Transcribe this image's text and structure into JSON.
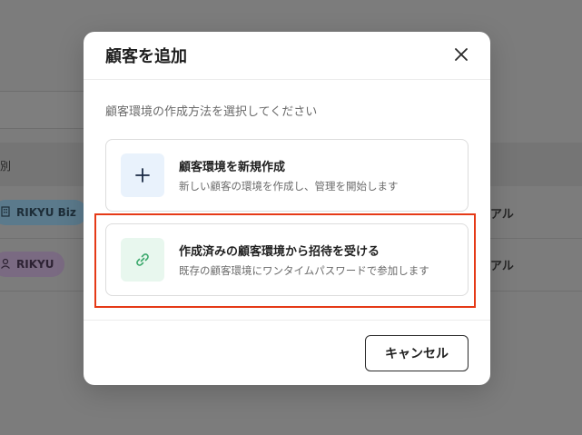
{
  "background": {
    "column_header": "種別",
    "rows": [
      {
        "badge": "RIKYU Biz",
        "cell": "アル"
      },
      {
        "badge": "RIKYU",
        "cell": "アル"
      }
    ]
  },
  "modal": {
    "title": "顧客を追加",
    "description": "顧客環境の作成方法を選択してください",
    "options": [
      {
        "title": "顧客環境を新規作成",
        "subtitle": "新しい顧客の環境を作成し、管理を開始します",
        "icon": "plus-icon"
      },
      {
        "title": "作成済みの顧客環境から招待を受ける",
        "subtitle": "既存の顧客環境にワンタイムパスワードで参加します",
        "icon": "link-icon",
        "highlighted": true
      }
    ],
    "cancel_label": "キャンセル"
  },
  "colors": {
    "overlay": "#7c7c7c",
    "highlight": "#e53a17",
    "new_icon_bg": "#e9f2fc",
    "invite_icon_bg": "#e8f7ee",
    "invite_icon": "#3aa86b",
    "new_icon": "#1a2a44"
  }
}
